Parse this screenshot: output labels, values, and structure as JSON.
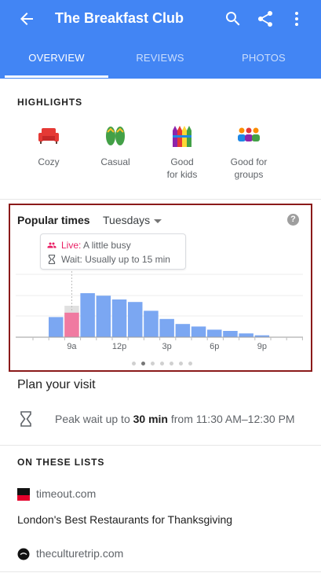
{
  "app": {
    "title": "The Breakfast Club",
    "colors": {
      "primary": "#4285f4",
      "live": "#e91e63",
      "bar": "#7ba7f2",
      "bar_live": "#f07aa1",
      "bar_live_ghost": "#e0e0e0"
    },
    "icons": {
      "back": "arrow-back-icon",
      "search": "search-icon",
      "share": "share-icon",
      "more": "more-vert-icon"
    }
  },
  "tabs": [
    {
      "label": "OVERVIEW",
      "active": true
    },
    {
      "label": "REVIEWS",
      "active": false
    },
    {
      "label": "PHOTOS",
      "active": false
    }
  ],
  "highlights": {
    "header": "HIGHLIGHTS",
    "items": [
      {
        "label": "Cozy",
        "icon": "sofa-icon"
      },
      {
        "label": "Casual",
        "icon": "flip-flops-icon"
      },
      {
        "label_lines": [
          "Good",
          "for kids"
        ],
        "icon": "crayons-icon"
      },
      {
        "label_lines": [
          "Good for",
          "groups"
        ],
        "icon": "group-icon"
      }
    ]
  },
  "popular_times": {
    "title": "Popular times",
    "day": "Tuesdays",
    "tooltip": {
      "live_label": "Live:",
      "live_value": "A little busy",
      "wait_text": "Wait: Usually up to 15 min"
    },
    "pager": {
      "count": 7,
      "active": 1
    }
  },
  "chart_data": {
    "type": "bar",
    "title": "Popular times",
    "x_tick_labels": [
      "9a",
      "12p",
      "3p",
      "6p",
      "9p"
    ],
    "hours": [
      "8a",
      "9a",
      "10a",
      "11a",
      "12p",
      "1p",
      "2p",
      "3p",
      "4p",
      "5p",
      "6p",
      "7p",
      "8p",
      "9p",
      "10p"
    ],
    "usual_busyness": [
      0.32,
      0.5,
      0.7,
      0.66,
      0.6,
      0.56,
      0.42,
      0.29,
      0.21,
      0.17,
      0.12,
      0.1,
      0.06,
      0.03,
      0
    ],
    "live_hour": "9a",
    "live_busyness": 0.39,
    "grid": true
  },
  "plan_visit": {
    "title": "Plan your visit",
    "peak_prefix": "Peak wait up to",
    "peak_bold": "30 min",
    "peak_suffix": "from 11:30 AM–12:30 PM"
  },
  "on_lists": {
    "header": "ON THESE LISTS",
    "items": [
      {
        "source": "timeout.com",
        "title": "London's Best Restaurants for Thanksgiving",
        "icon": "timeout-logo-icon"
      },
      {
        "source": "theculturetrip.com",
        "icon": "culture-trip-logo-icon"
      }
    ]
  }
}
